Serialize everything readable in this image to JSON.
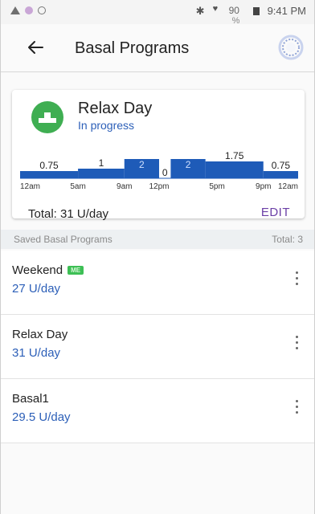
{
  "status_bar": {
    "battery_level": "90",
    "battery_unit": "%",
    "time": "9:41 PM"
  },
  "header": {
    "title": "Basal Programs"
  },
  "active_program": {
    "name": "Relax Day",
    "status": "In progress",
    "total_label": "Total: 31 U/day",
    "edit_label": "EDIT",
    "icon_color": "#3fae52"
  },
  "chart_data": {
    "type": "bar",
    "x_ticks": [
      "12am",
      "5am",
      "9am",
      "12pm",
      "5pm",
      "9pm",
      "12am"
    ],
    "segments": [
      {
        "start_hour": 0,
        "end_hour": 5,
        "value": 0.75,
        "label": "0.75",
        "label_inside": false
      },
      {
        "start_hour": 5,
        "end_hour": 9,
        "value": 1,
        "label": "1",
        "label_inside": false
      },
      {
        "start_hour": 9,
        "end_hour": 12,
        "value": 2,
        "label": "2",
        "label_inside": true
      },
      {
        "start_hour": 12,
        "end_hour": 13,
        "value": 0,
        "label": "0",
        "label_inside": false
      },
      {
        "start_hour": 13,
        "end_hour": 16,
        "value": 2,
        "label": "2",
        "label_inside": true
      },
      {
        "start_hour": 16,
        "end_hour": 21,
        "value": 1.75,
        "label": "1.75",
        "label_inside": false
      },
      {
        "start_hour": 21,
        "end_hour": 24,
        "value": 0.75,
        "label": "0.75",
        "label_inside": false
      }
    ],
    "bar_color": "#1e5bb8",
    "ylim": [
      0,
      2
    ]
  },
  "saved_section": {
    "label": "Saved Basal Programs",
    "total": "Total: 3"
  },
  "programs": [
    {
      "name": "Weekend",
      "value": "27 U/day",
      "badge": "ME"
    },
    {
      "name": "Relax Day",
      "value": "31 U/day",
      "badge": ""
    },
    {
      "name": "Basal1",
      "value": "29.5 U/day",
      "badge": ""
    }
  ],
  "colors": {
    "link_blue": "#2c5fb8",
    "edit_purple": "#6b3fa6",
    "badge_green": "#3dbf55"
  }
}
